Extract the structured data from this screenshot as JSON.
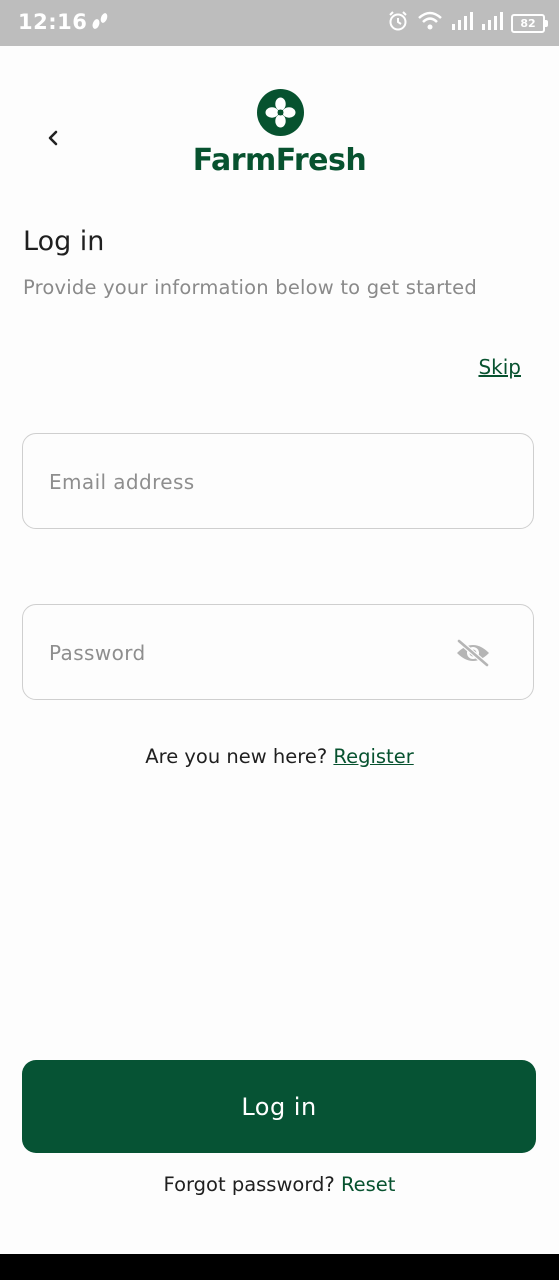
{
  "status_bar": {
    "time": "12:16",
    "battery": "82",
    "icons": [
      "footsteps-icon",
      "alarm-icon",
      "wifi-icon",
      "signal-icon",
      "signal-icon",
      "battery-icon"
    ]
  },
  "header": {
    "back_icon": "chevron-left-icon",
    "logo_icon": "clover-icon",
    "brand": "FarmFresh"
  },
  "page": {
    "title": "Log in",
    "subtitle": "Provide your information below to get started",
    "skip": "Skip"
  },
  "form": {
    "email_placeholder": "Email address",
    "email_value": "",
    "password_placeholder": "Password",
    "password_value": "",
    "password_toggle_icon": "eye-off-icon"
  },
  "register": {
    "prompt": "Are you new here?",
    "link": "Register"
  },
  "actions": {
    "login": "Log in",
    "forgot_prompt": "Forgot password?",
    "reset": "Reset"
  },
  "colors": {
    "brand": "#07522f",
    "button": "#065334",
    "status_bar": "#bdbdbd"
  }
}
